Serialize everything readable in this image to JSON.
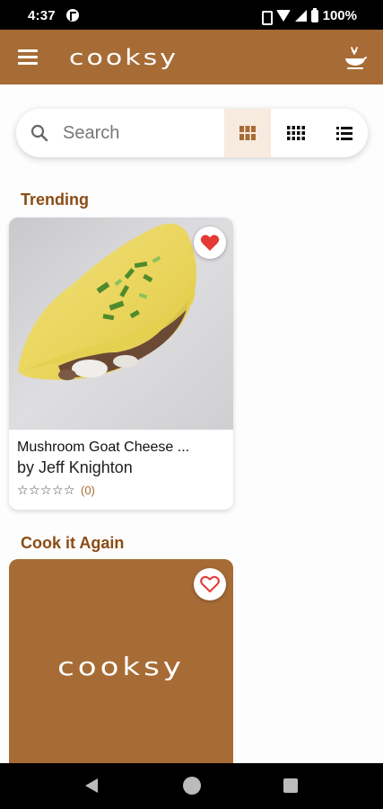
{
  "status_bar": {
    "time": "4:37",
    "battery": "100%"
  },
  "app_bar": {
    "title": "cooksy"
  },
  "search": {
    "placeholder": "Search"
  },
  "view_modes": [
    "large-grid",
    "small-grid",
    "list"
  ],
  "selected_view": "large-grid",
  "sections": {
    "trending": {
      "title": "Trending",
      "recipes": [
        {
          "title": "Mushroom Goat Cheese ...",
          "author": "by Jeff Knighton",
          "rating": 0,
          "rating_count": "(0)",
          "favorited": true
        }
      ]
    },
    "cook_again": {
      "title": "Cook it Again",
      "placeholder_logo": "cooksy",
      "favorited": false
    }
  },
  "colors": {
    "brand": "#a76c36",
    "section_title": "#8b4c14",
    "heart": "#e53935"
  }
}
